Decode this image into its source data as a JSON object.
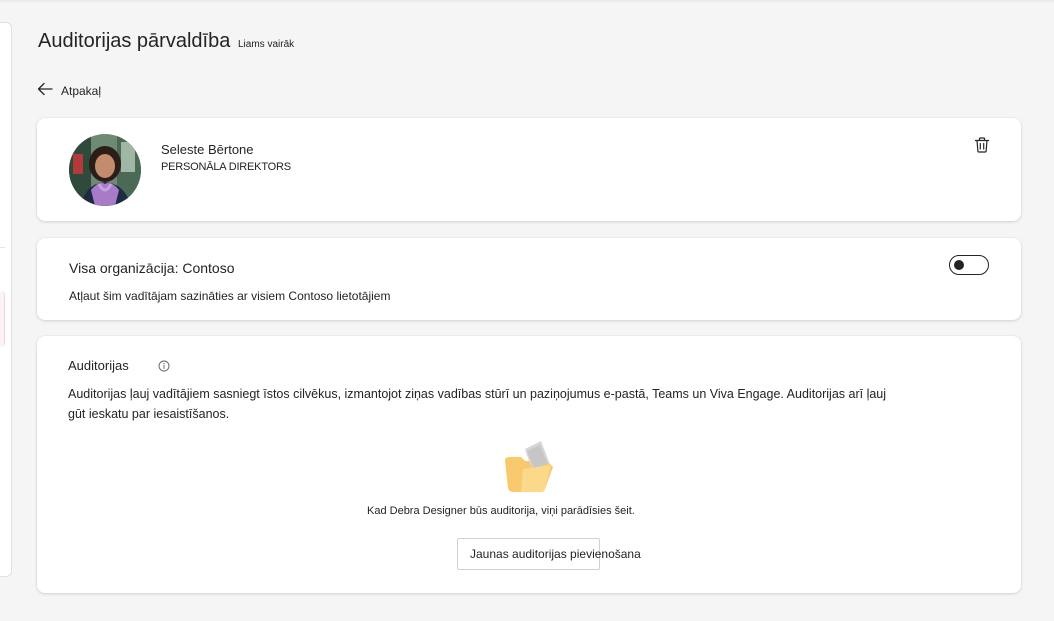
{
  "header": {
    "title": "Auditorijas pārvaldība",
    "learn_more": "Liams vairāk"
  },
  "nav": {
    "back_label": "Atpakaļ"
  },
  "person": {
    "name": "Seleste Bērtone",
    "role": "PERSONĀLA DIREKTORS",
    "avatar_icon": "person-photo",
    "delete_icon": "trash-icon"
  },
  "organization": {
    "title": "Visa organizācija: Contoso",
    "description": "Atļaut šim vadītājam sazināties ar visiem Contoso lietotājiem",
    "toggle_on": false
  },
  "audiences": {
    "title": "Auditorijas",
    "info_icon": "info-icon",
    "description": "Auditorijas ļauj vadītājiem sasniegt īstos cilvēkus, izmantojot ziņas vadības stūrī un paziņojumus e-pastā, Teams un Viva Engage. Auditorijas arī ļauj gūt ieskatu par iesaistīšanos.",
    "empty_message": "Kad Debra Designer būs auditorija, viņi parādīsies šeit.",
    "add_button": "Jaunas auditorijas pievienošana"
  },
  "colors": {
    "page_bg": "#f5f5f5",
    "card_bg": "#ffffff",
    "text": "#242424",
    "folder": "#f9c96d"
  }
}
